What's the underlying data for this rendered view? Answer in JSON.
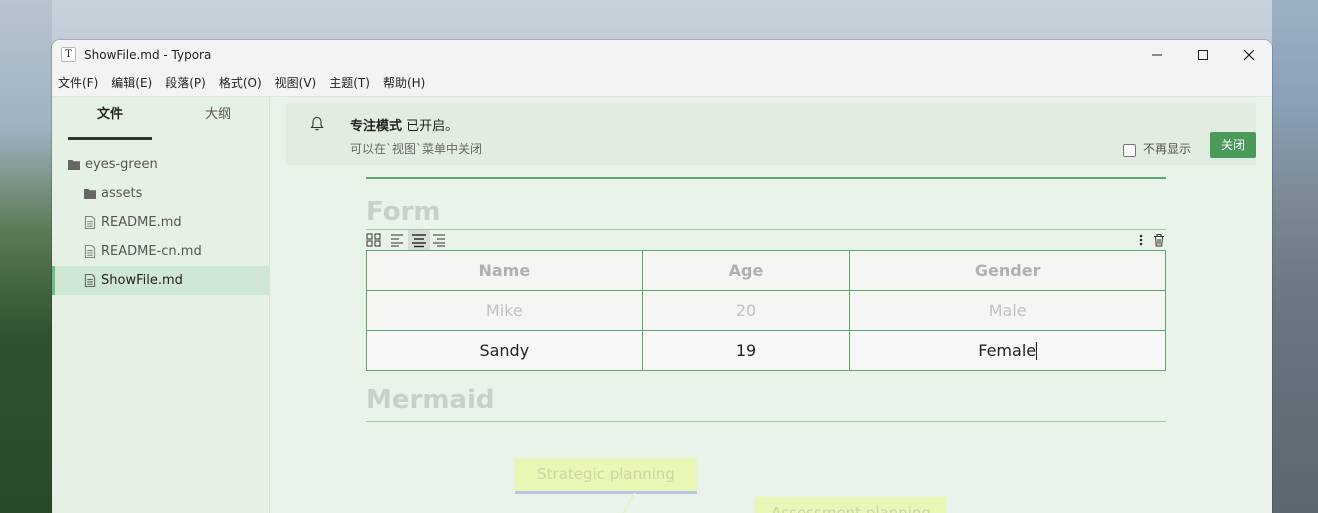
{
  "window": {
    "title": "ShowFile.md - Typora",
    "app_icon_letter": "T"
  },
  "menubar": {
    "items": [
      "文件(F)",
      "编辑(E)",
      "段落(P)",
      "格式(O)",
      "视图(V)",
      "主题(T)",
      "帮助(H)"
    ]
  },
  "sidebar": {
    "tabs": [
      "文件",
      "大纲"
    ],
    "active_tab": "文件",
    "tree": [
      {
        "label": "eyes-green",
        "kind": "folder"
      },
      {
        "label": "assets",
        "kind": "folder"
      },
      {
        "label": "README.md",
        "kind": "file"
      },
      {
        "label": "README-cn.md",
        "kind": "file"
      },
      {
        "label": "ShowFile.md",
        "kind": "file",
        "selected": true
      }
    ]
  },
  "notice": {
    "title_bold": "专注模式",
    "title_rest": " 已开启。",
    "subtitle": "可以在`视图`菜单中关闭",
    "checkbox_label": "不再显示",
    "checkbox_checked": false,
    "close_label": "关闭"
  },
  "document": {
    "form_heading": "Form",
    "table": {
      "headers": [
        "Name",
        "Age",
        "Gender"
      ],
      "rows": [
        [
          "Mike",
          "20",
          "Male"
        ],
        [
          "Sandy",
          "19",
          "Female"
        ]
      ]
    },
    "mermaid_heading": "Mermaid",
    "mermaid_nodes": [
      "Strategic planning",
      "Assessment planning"
    ]
  },
  "colors": {
    "accent": "#4c9a5a",
    "table_border": "#5ea670",
    "sidebar_bg": "#e6f1e6",
    "editor_bg": "#e9f3e9"
  }
}
